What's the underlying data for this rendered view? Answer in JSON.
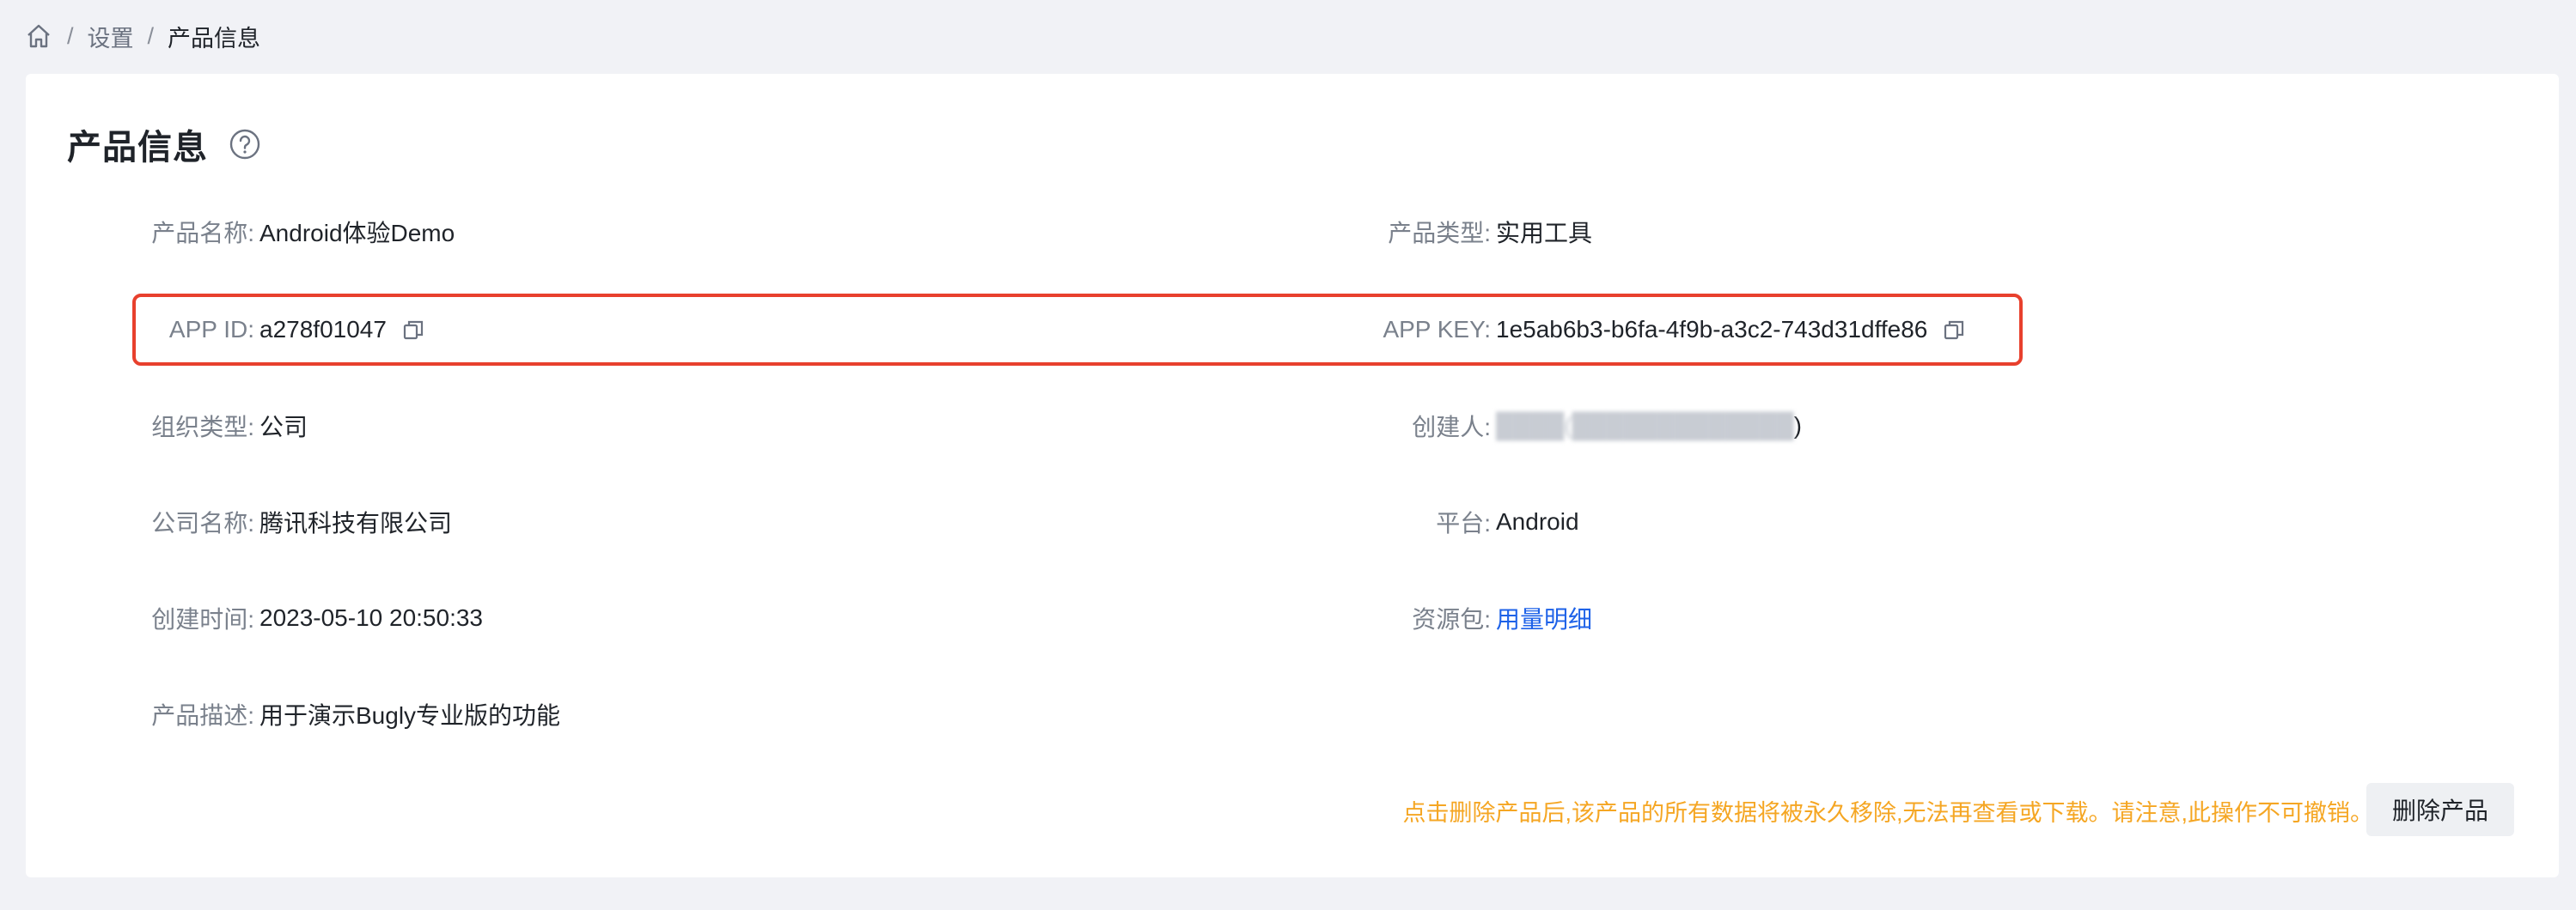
{
  "breadcrumb": {
    "home_icon": "home-icon",
    "separator": "/",
    "items": [
      "设置",
      "产品信息"
    ]
  },
  "page": {
    "title": "产品信息",
    "help_icon": "question-circle-icon"
  },
  "fields": {
    "product_name": {
      "label": "产品名称:",
      "value": "Android体验Demo"
    },
    "product_type": {
      "label": "产品类型:",
      "value": "实用工具"
    },
    "app_id": {
      "label": "APP ID:",
      "value": "a278f01047"
    },
    "app_key": {
      "label": "APP KEY:",
      "value": "1e5ab6b3-b6fa-4f9b-a3c2-743d31dffe86"
    },
    "org_type": {
      "label": "组织类型:",
      "value": "公司"
    },
    "creator": {
      "label": "创建人:",
      "value_close": ")"
    },
    "company_name": {
      "label": "公司名称:",
      "value": "腾讯科技有限公司"
    },
    "platform": {
      "label": "平台:",
      "value": "Android"
    },
    "created_time": {
      "label": "创建时间:",
      "value": "2023-05-10 20:50:33"
    },
    "resource_pack": {
      "label": "资源包:",
      "link": "用量明细"
    },
    "description": {
      "label": "产品描述:",
      "value": "用于演示Bugly专业版的功能"
    }
  },
  "danger_zone": {
    "warning": "点击删除产品后,该产品的所有数据将被永久移除,无法再查看或下载。请注意,此操作不可撤销。",
    "delete_label": "删除产品"
  },
  "colors": {
    "accent_link": "#1e62e8",
    "highlight_border": "#e8402d",
    "warning_text": "#f5a623",
    "background": "#f1f2f6"
  }
}
